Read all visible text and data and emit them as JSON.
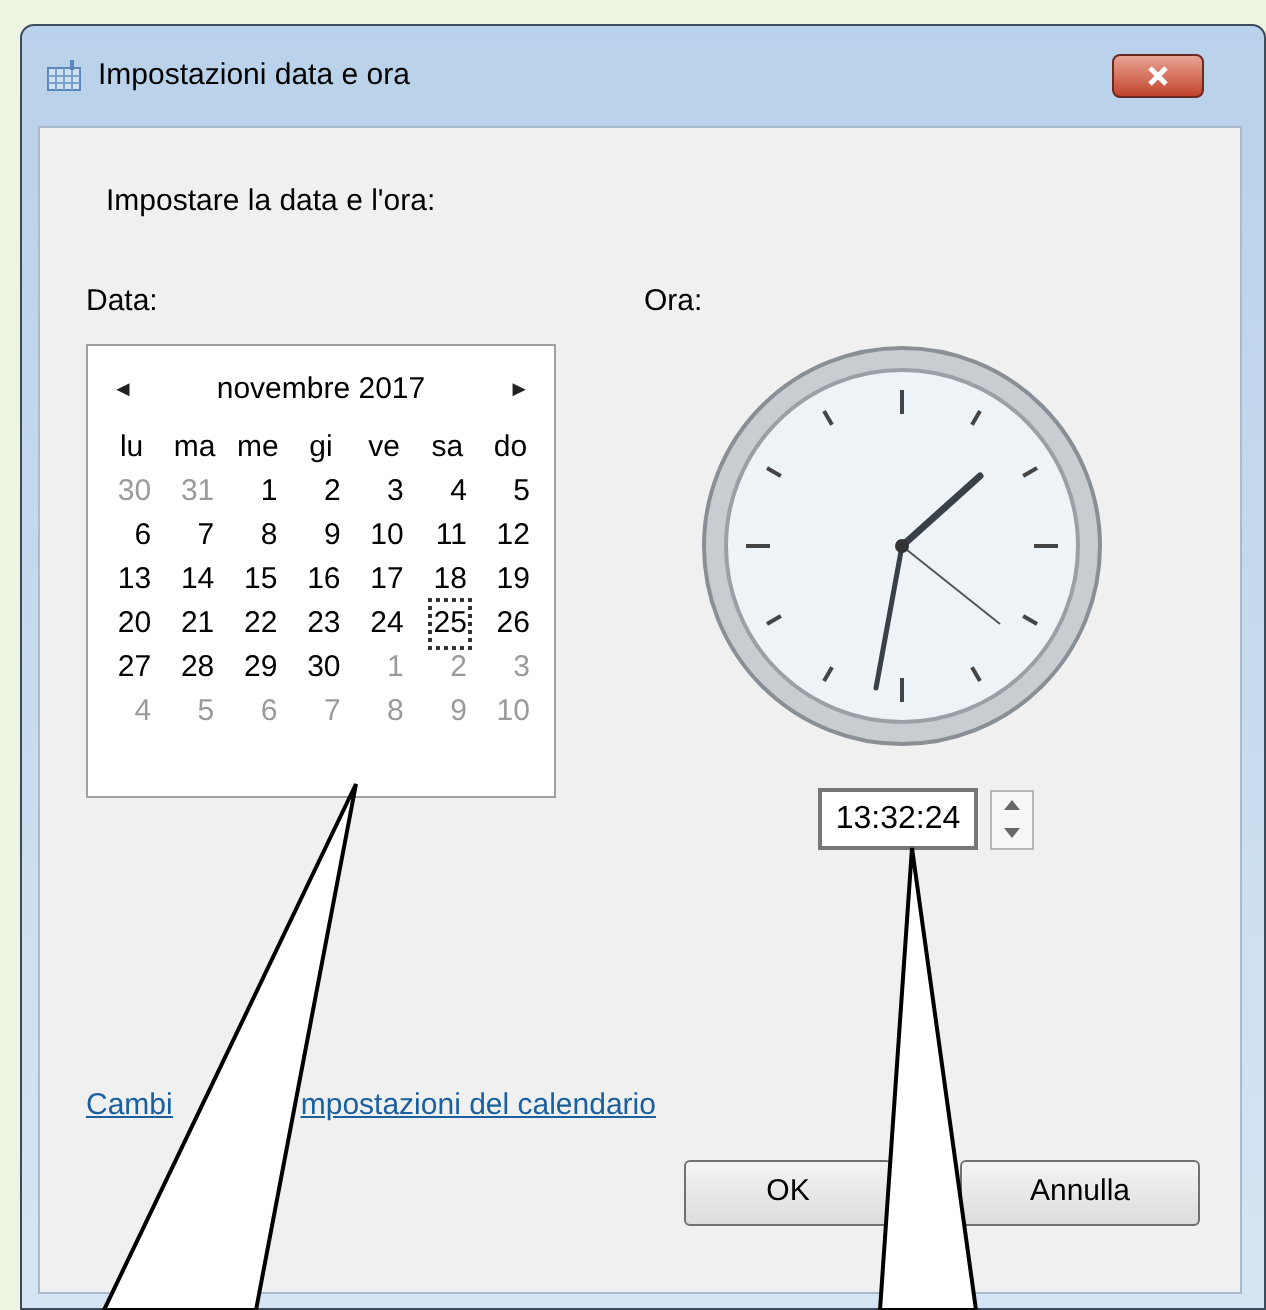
{
  "window": {
    "title": "Impostazioni data e ora"
  },
  "heading": "Impostare la data e l'ora:",
  "date_label": "Data:",
  "time_label": "Ora:",
  "calendar": {
    "month": "novembre 2017",
    "prev": "◄",
    "next": "►",
    "weekdays": [
      "lu",
      "ma",
      "me",
      "gi",
      "ve",
      "sa",
      "do"
    ],
    "weeks": [
      [
        {
          "day": "30",
          "other_month": true,
          "selected": false
        },
        {
          "day": "31",
          "other_month": true,
          "selected": false
        },
        {
          "day": "1",
          "other_month": false,
          "selected": false
        },
        {
          "day": "2",
          "other_month": false,
          "selected": false
        },
        {
          "day": "3",
          "other_month": false,
          "selected": false
        },
        {
          "day": "4",
          "other_month": false,
          "selected": false
        },
        {
          "day": "5",
          "other_month": false,
          "selected": false
        }
      ],
      [
        {
          "day": "6",
          "other_month": false,
          "selected": false
        },
        {
          "day": "7",
          "other_month": false,
          "selected": false
        },
        {
          "day": "8",
          "other_month": false,
          "selected": false
        },
        {
          "day": "9",
          "other_month": false,
          "selected": false
        },
        {
          "day": "10",
          "other_month": false,
          "selected": false
        },
        {
          "day": "11",
          "other_month": false,
          "selected": false
        },
        {
          "day": "12",
          "other_month": false,
          "selected": false
        }
      ],
      [
        {
          "day": "13",
          "other_month": false,
          "selected": false
        },
        {
          "day": "14",
          "other_month": false,
          "selected": false
        },
        {
          "day": "15",
          "other_month": false,
          "selected": false
        },
        {
          "day": "16",
          "other_month": false,
          "selected": false
        },
        {
          "day": "17",
          "other_month": false,
          "selected": false
        },
        {
          "day": "18",
          "other_month": false,
          "selected": false
        },
        {
          "day": "19",
          "other_month": false,
          "selected": false
        }
      ],
      [
        {
          "day": "20",
          "other_month": false,
          "selected": false
        },
        {
          "day": "21",
          "other_month": false,
          "selected": false
        },
        {
          "day": "22",
          "other_month": false,
          "selected": false
        },
        {
          "day": "23",
          "other_month": false,
          "selected": false
        },
        {
          "day": "24",
          "other_month": false,
          "selected": false
        },
        {
          "day": "25",
          "other_month": false,
          "selected": true
        },
        {
          "day": "26",
          "other_month": false,
          "selected": false
        }
      ],
      [
        {
          "day": "27",
          "other_month": false,
          "selected": false
        },
        {
          "day": "28",
          "other_month": false,
          "selected": false
        },
        {
          "day": "29",
          "other_month": false,
          "selected": false
        },
        {
          "day": "30",
          "other_month": false,
          "selected": false
        },
        {
          "day": "1",
          "other_month": true,
          "selected": false
        },
        {
          "day": "2",
          "other_month": true,
          "selected": false
        },
        {
          "day": "3",
          "other_month": true,
          "selected": false
        }
      ],
      [
        {
          "day": "4",
          "other_month": true,
          "selected": false
        },
        {
          "day": "5",
          "other_month": true,
          "selected": false
        },
        {
          "day": "6",
          "other_month": true,
          "selected": false
        },
        {
          "day": "7",
          "other_month": true,
          "selected": false
        },
        {
          "day": "8",
          "other_month": true,
          "selected": false
        },
        {
          "day": "9",
          "other_month": true,
          "selected": false
        },
        {
          "day": "10",
          "other_month": true,
          "selected": false
        }
      ]
    ]
  },
  "time_value": "13:32:24",
  "link_parts": [
    "Cambi",
    "mpostazioni del calendario"
  ],
  "buttons": [
    "OK",
    "Annulla"
  ]
}
